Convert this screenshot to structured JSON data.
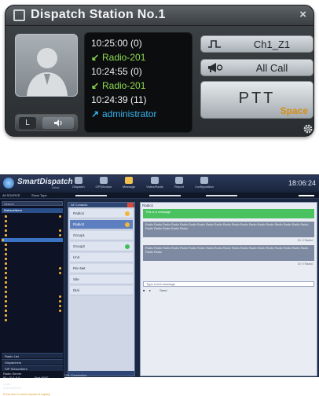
{
  "dispatch": {
    "title": "Dispatch Station No.1",
    "close": "×",
    "mini_left": "L",
    "log": [
      {
        "text": "10:25:00 (0)",
        "kind": "time"
      },
      {
        "text": "Radio-201",
        "kind": "in",
        "arrow": "↙"
      },
      {
        "text": "10:24:55 (0)",
        "kind": "time"
      },
      {
        "text": "Radio-201",
        "kind": "in",
        "arrow": "↙"
      },
      {
        "text": "10:24:39 (11)",
        "kind": "time"
      },
      {
        "text": "administrator",
        "kind": "out",
        "arrow": "↗"
      }
    ],
    "channel_label": "Ch1_Z1",
    "allcall_label": "All Call",
    "ptt_label": "PTT",
    "ptt_hotkey": "Space",
    "colors": {
      "incoming": "#8ddc50",
      "outgoing": "#3ab3f0",
      "hotkey": "#d58f14"
    }
  },
  "app": {
    "brand": "SmartDispatch",
    "brand_sub": "Initial",
    "nav": [
      "Dispatch",
      "GPS/Indoor",
      "Message",
      "Video/Radio",
      "Report",
      "Configuration"
    ],
    "active_nav": "Message",
    "clock": "18:06:24",
    "tool_left": "All SOURCE",
    "tool_mid": "Show Type",
    "search_placeholder": "Search",
    "subscribers_header": "Subscribers",
    "sections": [
      "Radio List",
      "Dispatchers",
      "SIP Subscribers"
    ],
    "profile_name": "Radio Server",
    "profile_ip": "IP : 10.1.0.0",
    "profile_port": "Port 9000",
    "login_title": "Login",
    "login_user": "Administrator",
    "footer": "Press here to send request of registry",
    "center_header": "All Contacts",
    "contacts": [
      "Radio1",
      "Radio2",
      "Group1",
      "Group2",
      "Unit",
      "Per-Net",
      "Site",
      "Dial"
    ],
    "chat_title": "Radio1",
    "msg_green": "This is a message",
    "msg_grey_1": "Radio Radio Radio Radio Radio Radio Radio Radio Radio Radio Radio Radio Radio Radio Radio Radio Radio Radio Radio Radio Radio Radio Radio Radio",
    "msg_grey_2": "Radio Radio Radio Radio Radio Radio Radio Radio Radio Radio Radio Radio Radio Radio Radio Radio Radio Radio Radio Radio Radio",
    "meta_1": "ID: 0 Radio1",
    "meta_2": "ID: 0 Radio1",
    "input_placeholder": "Type a text message",
    "send_label": "Send",
    "status": "ON: Connection"
  }
}
